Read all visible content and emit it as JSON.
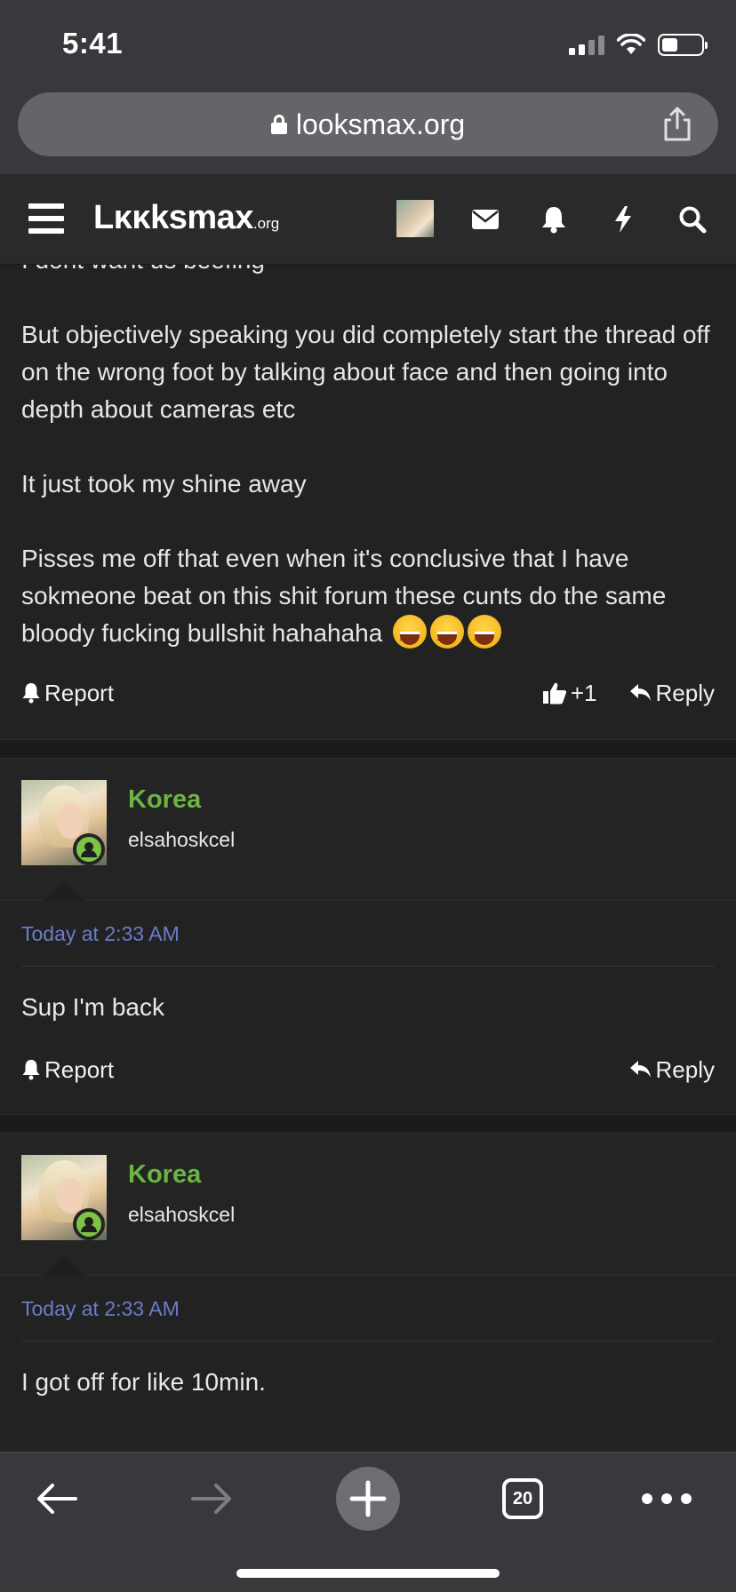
{
  "status_bar": {
    "time": "5:41"
  },
  "browser": {
    "url": "looksmax.org",
    "tab_count": "20"
  },
  "site_header": {
    "logo_main": "Lκκksmax",
    "logo_suffix": ".org"
  },
  "first_post": {
    "paragraphs": [
      "I dont want us beefing",
      "But objectively speaking you did completely start the thread off on the wrong foot by talking about face and then going into depth about cameras etc",
      "It just took my shine away",
      "Pisses me off that even when it's conclusive that I have sokmeone beat on this shit forum these cunts do the same bloody fucking bullshit hahahaha"
    ],
    "emoji_count": 3,
    "report_label": "Report",
    "like_count": "+1",
    "reply_label": "Reply"
  },
  "posts": [
    {
      "username": "Korea",
      "user_title": "elsahoskcel",
      "timestamp": "Today at 2:33 AM",
      "message": "Sup I'm back",
      "report_label": "Report",
      "reply_label": "Reply"
    },
    {
      "username": "Korea",
      "user_title": "elsahoskcel",
      "timestamp": "Today at 2:33 AM",
      "message": "I got off for like 10min."
    }
  ],
  "colors": {
    "username_green": "#6cb544",
    "timestamp_blue": "#6b7cc9",
    "background": "#222222"
  },
  "icons": [
    "lock-icon",
    "share-icon",
    "menu-icon",
    "mail-icon",
    "bell-icon",
    "bolt-icon",
    "search-icon",
    "thumbs-up-icon",
    "reply-icon",
    "back-icon",
    "forward-icon",
    "plus-icon",
    "tabs-icon",
    "more-icon"
  ]
}
